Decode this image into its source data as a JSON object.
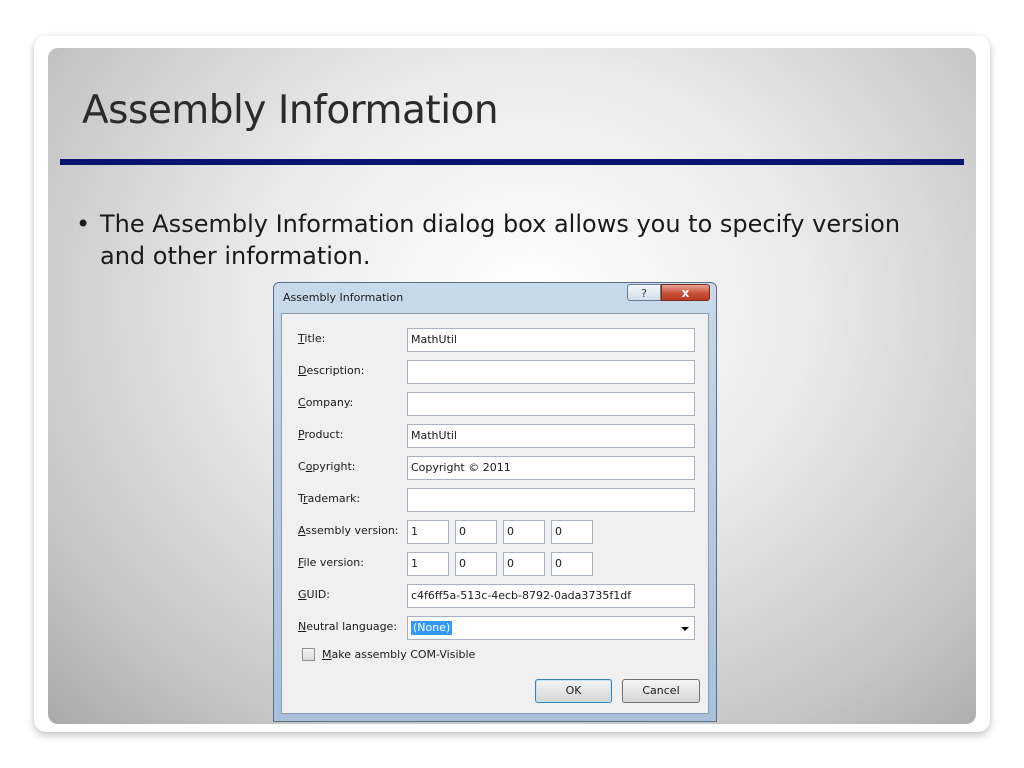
{
  "slide": {
    "title": "Assembly Information",
    "bullet": "The Assembly Information dialog box allows you to specify version and other information.",
    "bullet_marker": "•",
    "rule_color": "#0a1470"
  },
  "dialog": {
    "title": "Assembly Information",
    "help_glyph": "?",
    "close_glyph": "x",
    "fields": {
      "title": {
        "mnemonic": "T",
        "rest": "itle:",
        "value": "MathUtil"
      },
      "description": {
        "mnemonic": "D",
        "rest": "escription:",
        "value": ""
      },
      "company": {
        "mnemonic": "C",
        "rest": "ompany:",
        "value": ""
      },
      "product": {
        "mnemonic": "P",
        "rest": "roduct:",
        "value": "MathUtil"
      },
      "copyright": {
        "pre": "C",
        "mnemonic": "o",
        "rest": "pyright:",
        "value": "Copyright ©  2011"
      },
      "trademark": {
        "pre": "T",
        "mnemonic": "r",
        "rest": "ademark:",
        "value": ""
      },
      "guid": {
        "mnemonic": "G",
        "rest": "UID:",
        "value": "c4f6ff5a-513c-4ecb-8792-0ada3735f1df"
      }
    },
    "assembly_version": {
      "mnemonic": "A",
      "rest": "ssembly version:",
      "parts": [
        "1",
        "0",
        "0",
        "0"
      ]
    },
    "file_version": {
      "mnemonic": "F",
      "rest": "ile version:",
      "parts": [
        "1",
        "0",
        "0",
        "0"
      ]
    },
    "neutral_language": {
      "mnemonic": "N",
      "rest": "eutral language:",
      "value": "(None)"
    },
    "com_visible": {
      "mnemonic": "M",
      "rest": "ake assembly COM-Visible",
      "checked": false
    },
    "ok_label": "OK",
    "cancel_label": "Cancel"
  }
}
